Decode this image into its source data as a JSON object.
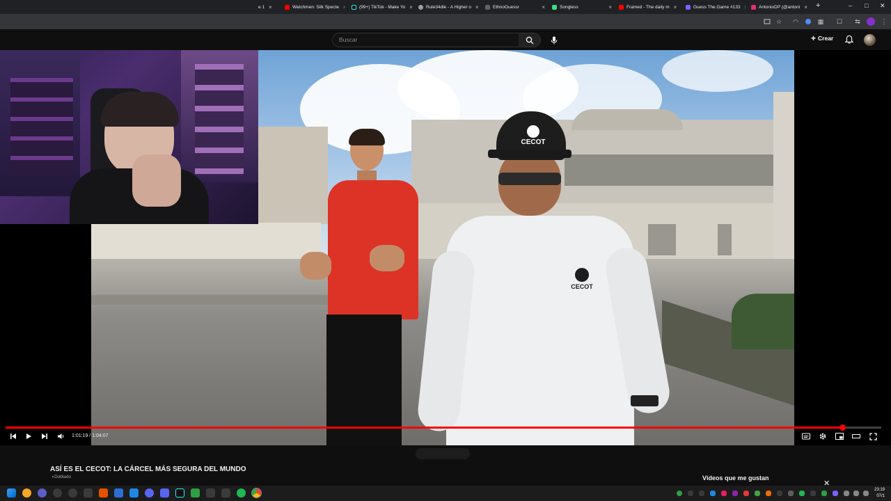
{
  "browser": {
    "tabs": [
      {
        "label": "e 1",
        "icon": "tab-favicon",
        "color": "#888888"
      },
      {
        "label": "Watchmen: Silk Specte",
        "icon": "youtube-icon",
        "color": "#ff0000"
      },
      {
        "label": "(99+) TikTok - Make Yo",
        "icon": "tiktok-icon",
        "color": "#111111"
      },
      {
        "label": "Rule34dle - A Higher o",
        "icon": "globe-icon",
        "color": "#9aa0a6"
      },
      {
        "label": "EthnoGuessr",
        "icon": "page-icon",
        "color": "#9aa0a6"
      },
      {
        "label": "Songless",
        "icon": "songless-icon",
        "color": "#3ddc84"
      },
      {
        "label": "Framed - The daily m",
        "icon": "youtube-icon",
        "color": "#ff0000"
      },
      {
        "label": "Guess The.Game #133",
        "icon": "game-icon",
        "color": "#7b61ff"
      },
      {
        "label": "AntonioDP (@antoni",
        "icon": "instagram-icon",
        "color": "#e1306c"
      }
    ],
    "new_tab": "+",
    "window_controls": {
      "minimize": "–",
      "maximize": "□",
      "close": "✕"
    }
  },
  "youtube": {
    "search_placeholder": "Buscar",
    "create_label": "Crear",
    "accent": "#ff0000"
  },
  "player": {
    "current_time": "1:01:19",
    "duration": "1:04:07",
    "time_separator": " / ",
    "progress_fraction": 0.956,
    "cap_logo_text": "CECOT",
    "chest_logo_text": "CECOT"
  },
  "video": {
    "title": "ASÍ ES EL CECOT: LA CÁRCEL MÁS SEGURA DEL MUNDO",
    "audio_badge": "Doblado"
  },
  "sidepanel": {
    "title": "Vídeos que me gustan",
    "close": "✕"
  },
  "taskbar": {
    "time": "23:19",
    "date": "07/1"
  }
}
